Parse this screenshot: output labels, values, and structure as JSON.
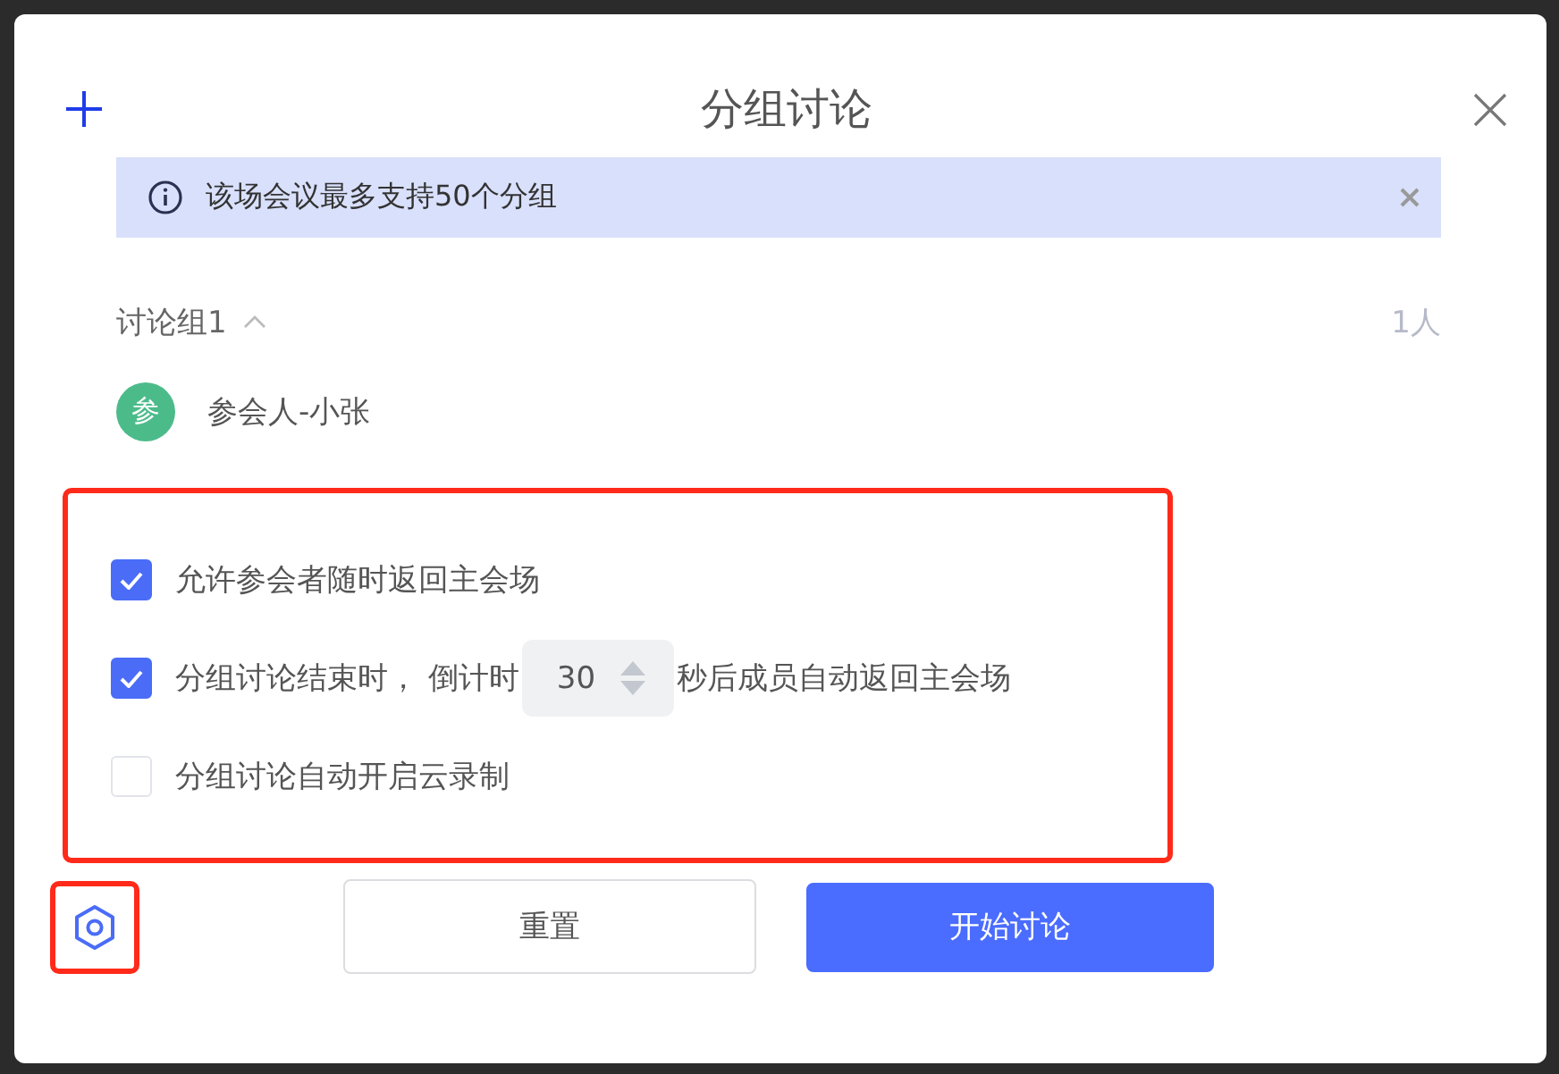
{
  "dialog": {
    "title": "分组讨论"
  },
  "notice": {
    "text": "该场会议最多支持50个分组"
  },
  "group": {
    "name": "讨论组1",
    "expanded": true,
    "count": "1人",
    "members": [
      {
        "avatar": "参",
        "name": "参会人-小张",
        "color": "#4cbb8a"
      }
    ]
  },
  "options": {
    "highlighted": true,
    "items": [
      {
        "kind": "checkbox",
        "label": "允许参会者随时返回主会场",
        "checked": true
      },
      {
        "kind": "countdown",
        "label_before": "分组讨论结束时， 倒计时",
        "value": "30",
        "label_after": "秒后成员自动返回主会场",
        "checked": true
      },
      {
        "kind": "checkbox",
        "label": "分组讨论自动开启云录制",
        "checked": false
      }
    ]
  },
  "settings": {
    "highlighted": true
  },
  "buttons": [
    {
      "kind": "secondary",
      "label": "重置"
    },
    {
      "kind": "primary",
      "label": "开始讨论"
    }
  ]
}
